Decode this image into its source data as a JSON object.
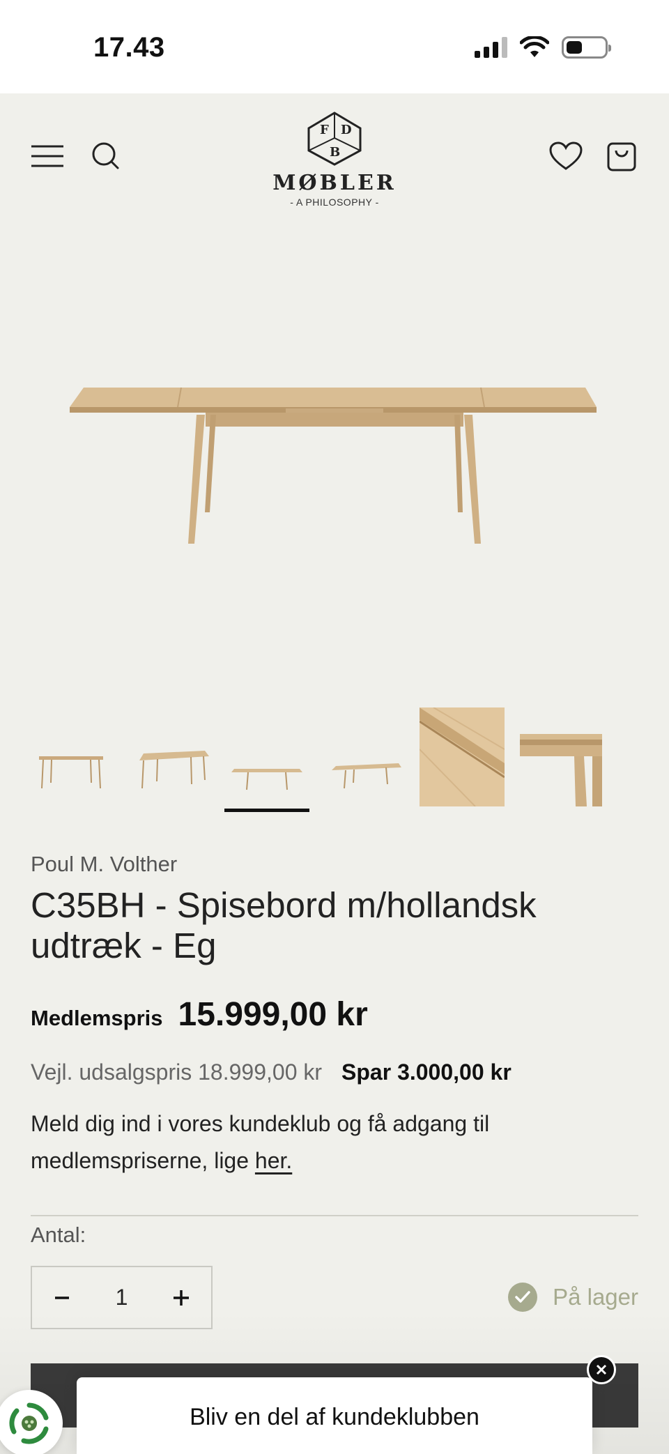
{
  "status_bar": {
    "time": "17.43"
  },
  "header": {
    "logo_word": "MØBLER",
    "logo_sub": "- A PHILOSOPHY -",
    "logo_letters": [
      "F",
      "D",
      "B"
    ],
    "icons": [
      "menu-icon",
      "search-icon",
      "heart-icon",
      "bag-icon"
    ]
  },
  "gallery": {
    "thumbnail_count": 6,
    "active_index": 2
  },
  "product": {
    "brand": "Poul M. Volther",
    "title": "C35BH - Spisebord m/hollandsk udtræk - Eg",
    "member_label": "Medlemspris",
    "member_price": "15.999,00 kr",
    "rrp": "Vejl. udsalgspris 18.999,00 kr",
    "save": "Spar 3.000,00 kr",
    "club_text": "Meld dig ind i vores kundeklub og få adgang til medlemspriserne, lige ",
    "club_link": "her."
  },
  "purchase": {
    "qty_label": "Antal:",
    "qty_value": "1",
    "minus": "−",
    "plus": "+",
    "stock": "På lager"
  },
  "popup": {
    "title": "Bliv en del af kundeklubben"
  },
  "colors": {
    "background": "#f0f0eb",
    "stock": "#a6aa8e",
    "cart_bar": "#3a3a3a",
    "oak": "#d2b48c"
  }
}
